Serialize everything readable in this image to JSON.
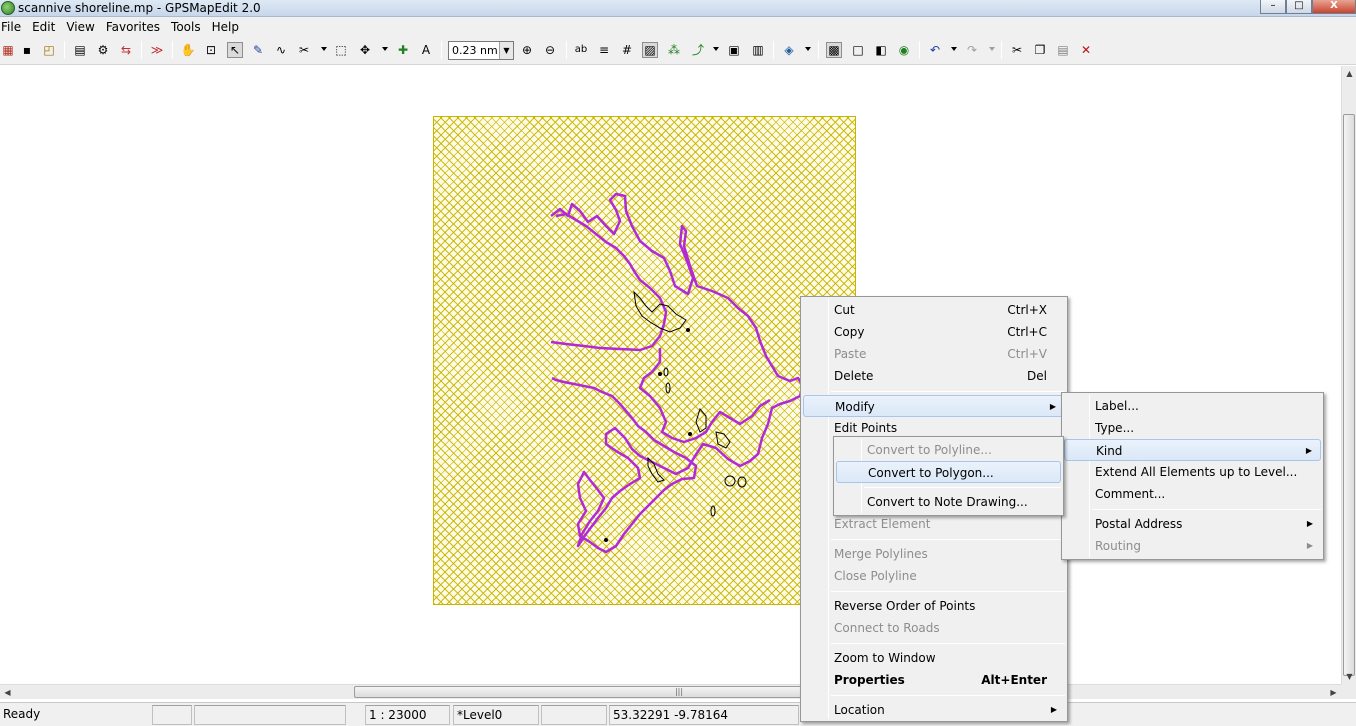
{
  "window": {
    "title": "scannive shoreline.mp - GPSMapEdit 2.0",
    "buttons": [
      "–",
      "□",
      "X"
    ]
  },
  "menubar": [
    "File",
    "Edit",
    "View",
    "Favorites",
    "Tools",
    "Help"
  ],
  "toolbar": {
    "zoom_value": "0.23 nm",
    "icons": [
      "new-map-icon",
      "save-icon",
      "open-icon",
      "map-properties-icon",
      "settings-icon",
      "transfer-icon",
      "track-icon",
      "hand-pan-icon",
      "zoom-rect-icon",
      "select-icon",
      "edit-node-icon",
      "polyline-icon",
      "trim-icon",
      "select-rect-icon",
      "move-icon",
      "create-point-icon",
      "label-icon",
      "zoom-in-icon",
      "zoom-out-icon",
      "show-labels-icon",
      "show-ruler-icon",
      "show-grid-icon",
      "show-polygons-icon",
      "show-points-icon",
      "route-icon",
      "properties-icon",
      "buildings-icon",
      "map-layer-icon",
      "pattern-fill-icon",
      "transparent-icon",
      "show-background-icon",
      "gps-icon",
      "undo-icon",
      "redo-icon",
      "cut-icon",
      "copy-icon",
      "paste-icon",
      "delete-icon"
    ]
  },
  "map": {
    "shoreline_color": "#b22ad6",
    "frame_color": "#c8b400"
  },
  "status_bar": {
    "ready": "Ready",
    "scale": "1 : 23000",
    "level": "*Level0",
    "coords": "53.32291 -9.78164"
  },
  "context_menu": {
    "items": [
      {
        "label": "Cut",
        "shortcut": "Ctrl+X",
        "disabled": false
      },
      {
        "label": "Copy",
        "shortcut": "Ctrl+C",
        "disabled": false
      },
      {
        "label": "Paste",
        "shortcut": "Ctrl+V",
        "disabled": true
      },
      {
        "label": "Delete",
        "shortcut": "Del",
        "disabled": false
      },
      {
        "label": "Modify",
        "submenu": true,
        "highlighted": true
      },
      {
        "label": "Edit Points"
      },
      {
        "label": "Extract Element",
        "disabled": true
      },
      {
        "label": "Merge Polylines",
        "disabled": true
      },
      {
        "label": "Close Polyline",
        "disabled": true
      },
      {
        "label": "Reverse Order of Points"
      },
      {
        "label": "Connect to Roads",
        "disabled": true
      },
      {
        "label": "Zoom to Window"
      },
      {
        "label": "Properties",
        "shortcut": "Alt+Enter",
        "bold": true
      },
      {
        "label": "Location",
        "submenu": true
      }
    ]
  },
  "modify_submenu": {
    "items": [
      {
        "label": "Label..."
      },
      {
        "label": "Type..."
      },
      {
        "label": "Kind",
        "submenu": true,
        "highlighted": true
      },
      {
        "label": "Extend All Elements up to Level..."
      },
      {
        "label": "Comment..."
      },
      {
        "label": "Postal Address",
        "submenu": true
      },
      {
        "label": "Routing",
        "submenu": true,
        "disabled": true
      }
    ]
  },
  "kind_submenu": {
    "items": [
      {
        "label": "Convert to Polyline...",
        "disabled": true
      },
      {
        "label": "Convert to Polygon...",
        "highlighted": true
      },
      {
        "label": "Convert to Note Drawing..."
      }
    ]
  }
}
